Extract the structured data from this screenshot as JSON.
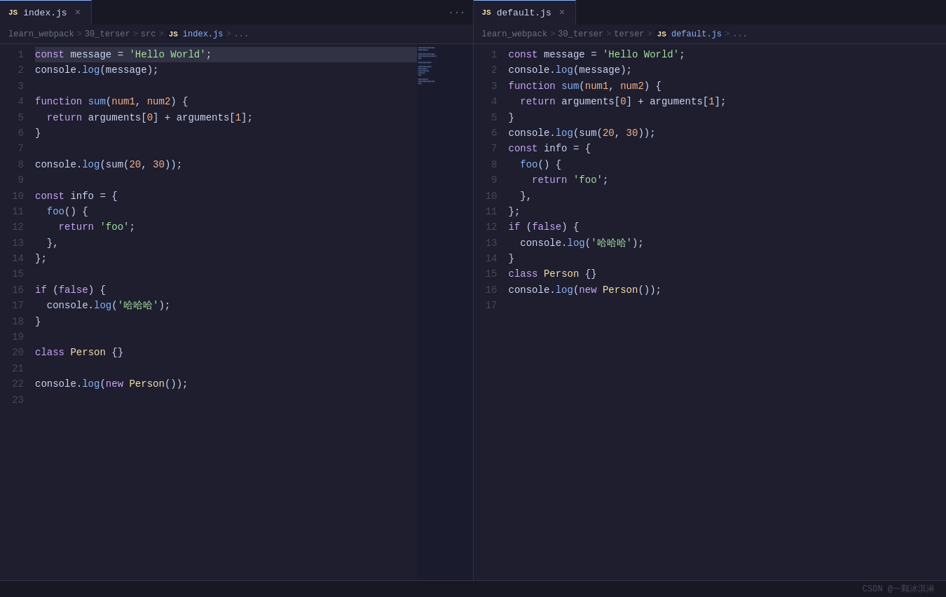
{
  "tabs": {
    "left": {
      "icon": "JS",
      "label": "index.js",
      "active": true,
      "close_label": "×",
      "more_label": "···"
    },
    "right": {
      "icon": "JS",
      "label": "default.js",
      "active": true,
      "close_label": "×"
    }
  },
  "breadcrumbs": {
    "left": {
      "parts": [
        "learn_webpack",
        ">",
        "30_terser",
        ">",
        "src",
        ">",
        "JS",
        "index.js",
        ">",
        "..."
      ]
    },
    "right": {
      "parts": [
        "learn_webpack",
        ">",
        "30_terser",
        ">",
        "terser",
        ">",
        "JS",
        "default.js",
        ">",
        "..."
      ]
    }
  },
  "left_code": [
    {
      "n": 1,
      "tokens": [
        {
          "t": "kw",
          "v": "const"
        },
        {
          "t": "plain",
          "v": " message = "
        },
        {
          "t": "str",
          "v": "'Hello World'"
        },
        {
          "t": "plain",
          "v": ";"
        }
      ],
      "highlight": true
    },
    {
      "n": 2,
      "tokens": [
        {
          "t": "plain",
          "v": "console."
        },
        {
          "t": "method",
          "v": "log"
        },
        {
          "t": "plain",
          "v": "(message);"
        }
      ]
    },
    {
      "n": 3,
      "tokens": []
    },
    {
      "n": 4,
      "tokens": [
        {
          "t": "kw",
          "v": "function"
        },
        {
          "t": "plain",
          "v": " "
        },
        {
          "t": "fn",
          "v": "sum"
        },
        {
          "t": "plain",
          "v": "("
        },
        {
          "t": "param",
          "v": "num1"
        },
        {
          "t": "plain",
          "v": ", "
        },
        {
          "t": "param",
          "v": "num2"
        },
        {
          "t": "plain",
          "v": ") {"
        }
      ]
    },
    {
      "n": 5,
      "tokens": [
        {
          "t": "plain",
          "v": "  "
        },
        {
          "t": "kw",
          "v": "return"
        },
        {
          "t": "plain",
          "v": " arguments["
        },
        {
          "t": "num",
          "v": "0"
        },
        {
          "t": "plain",
          "v": "] + arguments["
        },
        {
          "t": "num",
          "v": "1"
        },
        {
          "t": "plain",
          "v": "];"
        }
      ]
    },
    {
      "n": 6,
      "tokens": [
        {
          "t": "plain",
          "v": "}"
        }
      ]
    },
    {
      "n": 7,
      "tokens": []
    },
    {
      "n": 8,
      "tokens": [
        {
          "t": "plain",
          "v": "console."
        },
        {
          "t": "method",
          "v": "log"
        },
        {
          "t": "plain",
          "v": "(sum("
        },
        {
          "t": "num",
          "v": "20"
        },
        {
          "t": "plain",
          "v": ", "
        },
        {
          "t": "num",
          "v": "30"
        },
        {
          "t": "plain",
          "v": "));"
        }
      ]
    },
    {
      "n": 9,
      "tokens": []
    },
    {
      "n": 10,
      "tokens": [
        {
          "t": "kw",
          "v": "const"
        },
        {
          "t": "plain",
          "v": " info = {"
        }
      ]
    },
    {
      "n": 11,
      "tokens": [
        {
          "t": "plain",
          "v": "  "
        },
        {
          "t": "fn",
          "v": "foo"
        },
        {
          "t": "plain",
          "v": "() {"
        }
      ]
    },
    {
      "n": 12,
      "tokens": [
        {
          "t": "plain",
          "v": "    "
        },
        {
          "t": "kw",
          "v": "return"
        },
        {
          "t": "plain",
          "v": " "
        },
        {
          "t": "str",
          "v": "'foo'"
        },
        {
          "t": "plain",
          "v": ";"
        }
      ]
    },
    {
      "n": 13,
      "tokens": [
        {
          "t": "plain",
          "v": "  },"
        }
      ]
    },
    {
      "n": 14,
      "tokens": [
        {
          "t": "plain",
          "v": "};"
        }
      ]
    },
    {
      "n": 15,
      "tokens": []
    },
    {
      "n": 16,
      "tokens": [
        {
          "t": "kw",
          "v": "if"
        },
        {
          "t": "plain",
          "v": " ("
        },
        {
          "t": "kw",
          "v": "false"
        },
        {
          "t": "plain",
          "v": ") {"
        }
      ]
    },
    {
      "n": 17,
      "tokens": [
        {
          "t": "plain",
          "v": "  console."
        },
        {
          "t": "method",
          "v": "log"
        },
        {
          "t": "plain",
          "v": "("
        },
        {
          "t": "str",
          "v": "'哈哈哈'"
        },
        {
          "t": "plain",
          "v": ");"
        }
      ]
    },
    {
      "n": 18,
      "tokens": [
        {
          "t": "plain",
          "v": "}"
        }
      ]
    },
    {
      "n": 19,
      "tokens": []
    },
    {
      "n": 20,
      "tokens": [
        {
          "t": "kw",
          "v": "class"
        },
        {
          "t": "plain",
          "v": " "
        },
        {
          "t": "cls",
          "v": "Person"
        },
        {
          "t": "plain",
          "v": " {}"
        }
      ]
    },
    {
      "n": 21,
      "tokens": []
    },
    {
      "n": 22,
      "tokens": [
        {
          "t": "plain",
          "v": "console."
        },
        {
          "t": "method",
          "v": "log"
        },
        {
          "t": "plain",
          "v": "("
        },
        {
          "t": "kw",
          "v": "new"
        },
        {
          "t": "plain",
          "v": " "
        },
        {
          "t": "cls",
          "v": "Person"
        },
        {
          "t": "plain",
          "v": "());"
        }
      ]
    },
    {
      "n": 23,
      "tokens": []
    }
  ],
  "right_code": [
    {
      "n": 1,
      "tokens": [
        {
          "t": "kw",
          "v": "const"
        },
        {
          "t": "plain",
          "v": " message = "
        },
        {
          "t": "str",
          "v": "'Hello World'"
        },
        {
          "t": "plain",
          "v": ";"
        }
      ]
    },
    {
      "n": 2,
      "tokens": [
        {
          "t": "plain",
          "v": "console."
        },
        {
          "t": "method",
          "v": "log"
        },
        {
          "t": "plain",
          "v": "(message);"
        }
      ]
    },
    {
      "n": 3,
      "tokens": [
        {
          "t": "kw",
          "v": "function"
        },
        {
          "t": "plain",
          "v": " "
        },
        {
          "t": "fn",
          "v": "sum"
        },
        {
          "t": "plain",
          "v": "("
        },
        {
          "t": "param",
          "v": "num1"
        },
        {
          "t": "plain",
          "v": ", "
        },
        {
          "t": "param",
          "v": "num2"
        },
        {
          "t": "plain",
          "v": ") {"
        }
      ]
    },
    {
      "n": 4,
      "tokens": [
        {
          "t": "plain",
          "v": "  "
        },
        {
          "t": "kw",
          "v": "return"
        },
        {
          "t": "plain",
          "v": " arguments["
        },
        {
          "t": "num",
          "v": "0"
        },
        {
          "t": "plain",
          "v": "] + arguments["
        },
        {
          "t": "num",
          "v": "1"
        },
        {
          "t": "plain",
          "v": "];"
        }
      ]
    },
    {
      "n": 5,
      "tokens": [
        {
          "t": "plain",
          "v": "}"
        }
      ]
    },
    {
      "n": 6,
      "tokens": [
        {
          "t": "plain",
          "v": "console."
        },
        {
          "t": "method",
          "v": "log"
        },
        {
          "t": "plain",
          "v": "(sum("
        },
        {
          "t": "num",
          "v": "20"
        },
        {
          "t": "plain",
          "v": ", "
        },
        {
          "t": "num",
          "v": "30"
        },
        {
          "t": "plain",
          "v": "));"
        }
      ]
    },
    {
      "n": 7,
      "tokens": [
        {
          "t": "kw",
          "v": "const"
        },
        {
          "t": "plain",
          "v": " info = {"
        }
      ]
    },
    {
      "n": 8,
      "tokens": [
        {
          "t": "plain",
          "v": "  "
        },
        {
          "t": "fn",
          "v": "foo"
        },
        {
          "t": "plain",
          "v": "() {"
        }
      ]
    },
    {
      "n": 9,
      "tokens": [
        {
          "t": "plain",
          "v": "    "
        },
        {
          "t": "kw",
          "v": "return"
        },
        {
          "t": "plain",
          "v": " "
        },
        {
          "t": "str",
          "v": "'foo'"
        },
        {
          "t": "plain",
          "v": ";"
        }
      ]
    },
    {
      "n": 10,
      "tokens": [
        {
          "t": "plain",
          "v": "  },"
        }
      ]
    },
    {
      "n": 11,
      "tokens": [
        {
          "t": "plain",
          "v": "};"
        }
      ]
    },
    {
      "n": 12,
      "tokens": [
        {
          "t": "kw",
          "v": "if"
        },
        {
          "t": "plain",
          "v": " ("
        },
        {
          "t": "kw",
          "v": "false"
        },
        {
          "t": "plain",
          "v": ") {"
        }
      ]
    },
    {
      "n": 13,
      "tokens": [
        {
          "t": "plain",
          "v": "  console."
        },
        {
          "t": "method",
          "v": "log"
        },
        {
          "t": "plain",
          "v": "("
        },
        {
          "t": "str",
          "v": "'哈哈哈'"
        },
        {
          "t": "plain",
          "v": ");"
        }
      ]
    },
    {
      "n": 14,
      "tokens": [
        {
          "t": "plain",
          "v": "}"
        }
      ]
    },
    {
      "n": 15,
      "tokens": [
        {
          "t": "kw",
          "v": "class"
        },
        {
          "t": "plain",
          "v": " "
        },
        {
          "t": "cls",
          "v": "Person"
        },
        {
          "t": "plain",
          "v": " {}"
        }
      ]
    },
    {
      "n": 16,
      "tokens": [
        {
          "t": "plain",
          "v": "console."
        },
        {
          "t": "method",
          "v": "log"
        },
        {
          "t": "plain",
          "v": "("
        },
        {
          "t": "kw",
          "v": "new"
        },
        {
          "t": "plain",
          "v": " "
        },
        {
          "t": "cls",
          "v": "Person"
        },
        {
          "t": "plain",
          "v": "());"
        }
      ]
    },
    {
      "n": 17,
      "tokens": []
    }
  ],
  "status": {
    "watermark": "CSDN @一颗冰淇淋"
  }
}
